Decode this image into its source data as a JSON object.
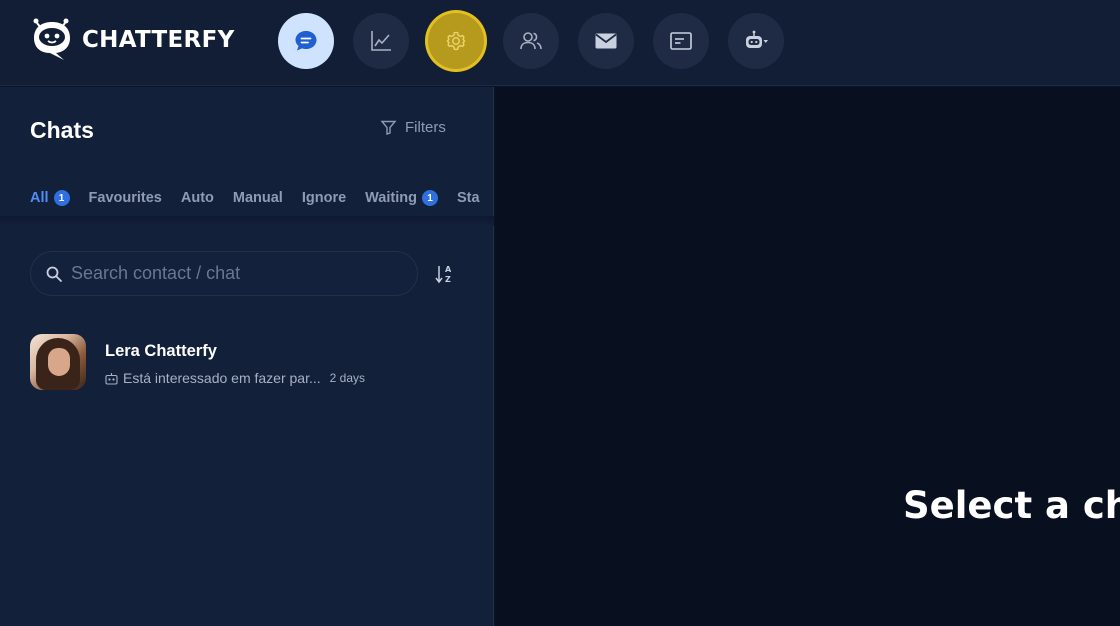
{
  "header": {
    "brand": "CHATTERFY",
    "nav": [
      {
        "id": "chats",
        "icon": "chat-bubble-icon",
        "active": true
      },
      {
        "id": "analytics",
        "icon": "line-chart-icon"
      },
      {
        "id": "settings",
        "icon": "gear-icon",
        "highlighted": true
      },
      {
        "id": "contacts",
        "icon": "users-icon"
      },
      {
        "id": "broadcasts",
        "icon": "mail-icon"
      },
      {
        "id": "templates",
        "icon": "card-icon"
      },
      {
        "id": "bots",
        "icon": "robot-icon",
        "has_dropdown": true
      }
    ]
  },
  "sidebar": {
    "title": "Chats",
    "filters_label": "Filters",
    "tabs": [
      {
        "label": "All",
        "badge": "1",
        "active": true
      },
      {
        "label": "Favourites"
      },
      {
        "label": "Auto"
      },
      {
        "label": "Manual"
      },
      {
        "label": "Ignore"
      },
      {
        "label": "Waiting",
        "badge": "1"
      },
      {
        "label": "Sta"
      }
    ],
    "search": {
      "placeholder": "Search contact / chat",
      "value": ""
    },
    "chats": [
      {
        "name": "Lera Chatterfy",
        "preview": "Está interessado em fazer par...",
        "time": "2 days"
      }
    ]
  },
  "main": {
    "empty_title": "Select a cha"
  },
  "colors": {
    "accent": "#4f8df5",
    "highlight": "#e3c021",
    "topbar": "#111e36",
    "panel": "#13203a",
    "content": "#080f1f"
  }
}
